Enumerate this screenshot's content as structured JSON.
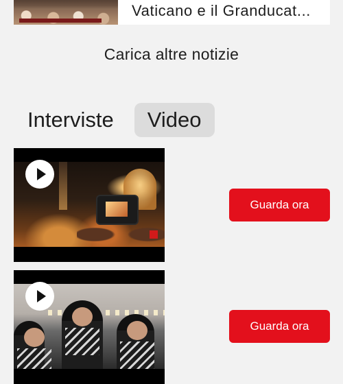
{
  "news_card": {
    "title": "Vaticano e il Granducat..."
  },
  "load_more_label": "Carica altre notizie",
  "tabs": [
    {
      "label": "Interviste",
      "active": false
    },
    {
      "label": "Video",
      "active": true
    }
  ],
  "videos": [
    {
      "action_label": "Guarda ora",
      "play_icon": "play-icon"
    },
    {
      "action_label": "Guarda ora",
      "play_icon": "play-icon"
    }
  ],
  "colors": {
    "background": "#f2f2f2",
    "accent_red": "#e3101c",
    "active_tab": "#dcdcdc"
  }
}
